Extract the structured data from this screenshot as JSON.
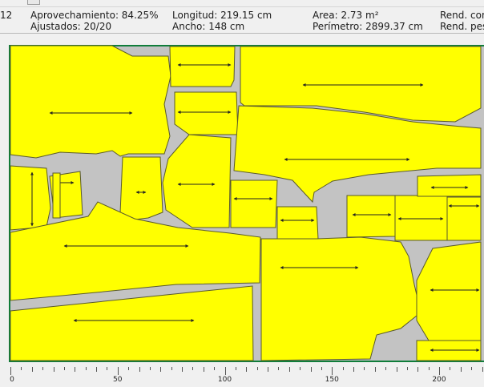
{
  "status": {
    "left_fragment": "12",
    "efficiency": "Aprovechamiento: 84.25%",
    "fitted": "Ajustados: 20/20",
    "length": "Longitud: 219.15 cm",
    "width": "Ancho: 148 cm",
    "area": "Area: 2.73 m²",
    "perimeter": "Perímetro: 2899.37 cm",
    "rend_1": "Rend. con",
    "rend_2": "Rend. pes"
  },
  "ruler": {
    "labels": [
      "0",
      "50",
      "100",
      "150",
      "200"
    ]
  },
  "colors": {
    "piece_fill": "#ffff00",
    "piece_stroke": "#5a5a2a",
    "marker_background": "#c3c3c3",
    "marker_border": "#0f7d3a"
  }
}
